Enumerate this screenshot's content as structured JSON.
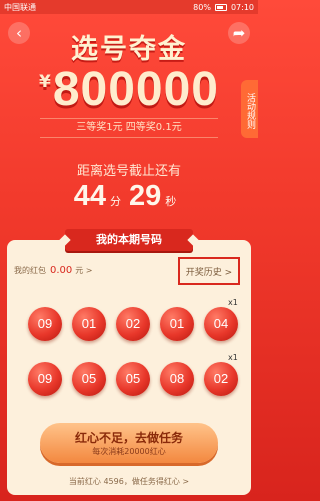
{
  "status_bar": {
    "carrier": "中国联通",
    "battery": "80%",
    "time": "07:10"
  },
  "header": {
    "title": "选号夺金",
    "currency": "¥",
    "prize": "800000"
  },
  "prize_info": "三等奖1元 四等奖0.1元",
  "side_tab": "活动规则",
  "deadline": {
    "label": "距离选号截止还有",
    "minutes": "44",
    "minutes_unit": "分",
    "seconds": "29",
    "seconds_unit": "秒"
  },
  "card": {
    "title": "我的本期号码",
    "wallet_label": "我的红包",
    "wallet_value": "0.00",
    "wallet_unit": "元 >",
    "history_link": "开奖历史 >",
    "rows": [
      {
        "balls": [
          "09",
          "01",
          "02",
          "01",
          "04"
        ],
        "multiplier": "x1"
      },
      {
        "balls": [
          "09",
          "05",
          "05",
          "08",
          "02"
        ],
        "multiplier": "x1"
      }
    ],
    "task_button": "红心不足，去做任务",
    "task_sub": "每次消耗20000红心",
    "footer": "当前红心 4596，做任务得红心 >"
  },
  "colors": {
    "accent": "#d9281e",
    "card_bg": "#fdf0dc",
    "button": "#f3883f"
  }
}
